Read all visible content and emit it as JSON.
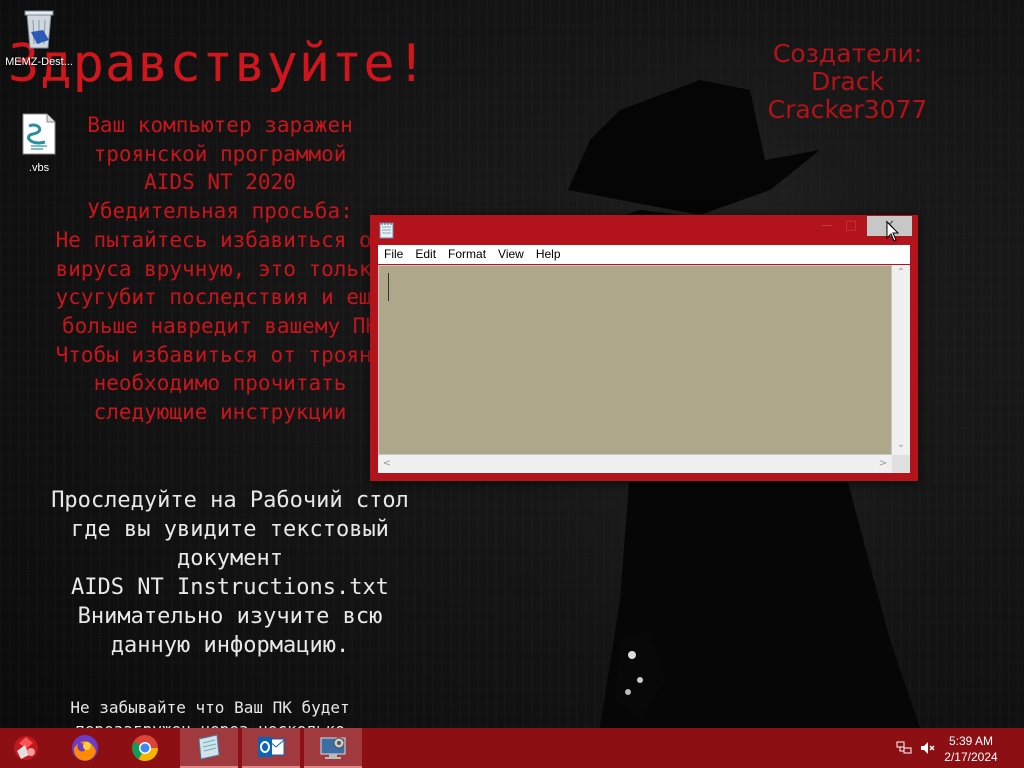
{
  "desktop": {
    "icons": [
      {
        "label": "MEMZ-Dest...",
        "icon": "recycle-bin-icon"
      },
      {
        "label": ".vbs",
        "icon": "script-file-icon"
      }
    ]
  },
  "wallpaper": {
    "greeting": "Здравствуйте!",
    "warning_lines": [
      "Ваш компьютер заражен",
      "троянской программой",
      "AIDS NT 2020",
      "Убедительная просьба:",
      "Не пытайтесь избавиться от",
      "вируса вручную, это только",
      "усугубит последствия и еще",
      "больше навредит вашему ПК",
      "Чтобы избавиться от трояна",
      "необходимо прочитать",
      "следующие инструкции"
    ],
    "creators_lines": [
      "Создатели:",
      "Drack",
      "Cracker3077"
    ],
    "instruction_lines": [
      "Проследуйте на Рабочий стол",
      "где вы увидите текстовый",
      "документ",
      "AIDS NT Instructions.txt",
      "Внимательно изучите всю",
      "данную информацию."
    ],
    "footer_lines": [
      "Не забывайте что Ваш ПК будет",
      "перезагружен через несколько"
    ]
  },
  "notepad": {
    "title": "",
    "menu": [
      "File",
      "Edit",
      "Format",
      "View",
      "Help"
    ],
    "content": "",
    "colors": {
      "frame": "#b3131a",
      "text_area": "#aea78a"
    }
  },
  "taskbar": {
    "items": [
      {
        "name": "start-button",
        "icon": "start-orb-icon"
      },
      {
        "name": "firefox",
        "icon": "firefox-icon"
      },
      {
        "name": "chrome",
        "icon": "chrome-icon"
      },
      {
        "name": "notepad",
        "icon": "notepad-icon"
      },
      {
        "name": "outlook",
        "icon": "outlook-icon"
      },
      {
        "name": "control-panel",
        "icon": "control-panel-icon"
      }
    ],
    "clock_time": "5:39 AM",
    "clock_date": "2/17/2024",
    "color": "#8c0f14"
  }
}
